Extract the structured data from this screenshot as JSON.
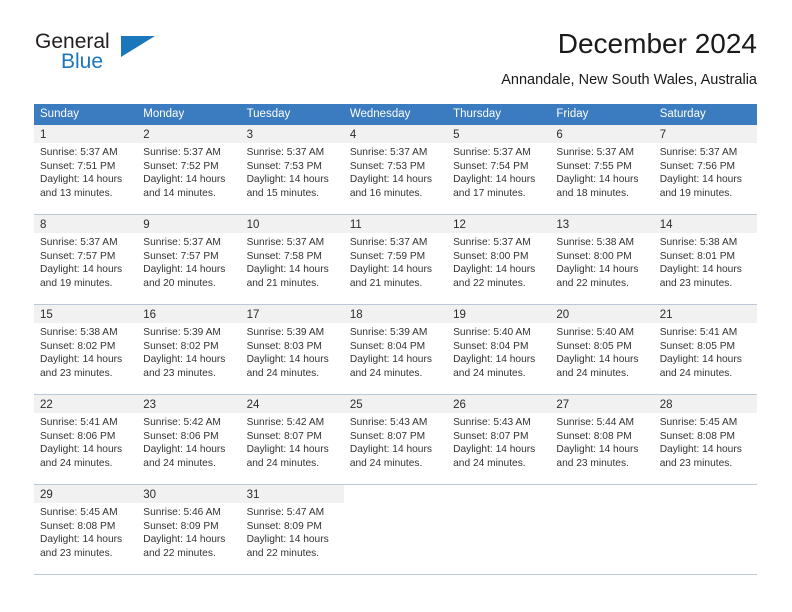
{
  "brand": {
    "name_part1": "General",
    "name_part2": "Blue",
    "triangle_color": "#1b76bc"
  },
  "header": {
    "title": "December 2024",
    "subtitle": "Annandale, New South Wales, Australia"
  },
  "theme": {
    "header_blue": "#3a7cbf",
    "daynum_band": "#f1f1f1",
    "row_divider": "#b9c9d8"
  },
  "calendar": {
    "weekdays": [
      "Sunday",
      "Monday",
      "Tuesday",
      "Wednesday",
      "Thursday",
      "Friday",
      "Saturday"
    ],
    "weeks": [
      [
        {
          "day": "1",
          "sunrise": "Sunrise: 5:37 AM",
          "sunset": "Sunset: 7:51 PM",
          "daylight1": "Daylight: 14 hours",
          "daylight2": "and 13 minutes."
        },
        {
          "day": "2",
          "sunrise": "Sunrise: 5:37 AM",
          "sunset": "Sunset: 7:52 PM",
          "daylight1": "Daylight: 14 hours",
          "daylight2": "and 14 minutes."
        },
        {
          "day": "3",
          "sunrise": "Sunrise: 5:37 AM",
          "sunset": "Sunset: 7:53 PM",
          "daylight1": "Daylight: 14 hours",
          "daylight2": "and 15 minutes."
        },
        {
          "day": "4",
          "sunrise": "Sunrise: 5:37 AM",
          "sunset": "Sunset: 7:53 PM",
          "daylight1": "Daylight: 14 hours",
          "daylight2": "and 16 minutes."
        },
        {
          "day": "5",
          "sunrise": "Sunrise: 5:37 AM",
          "sunset": "Sunset: 7:54 PM",
          "daylight1": "Daylight: 14 hours",
          "daylight2": "and 17 minutes."
        },
        {
          "day": "6",
          "sunrise": "Sunrise: 5:37 AM",
          "sunset": "Sunset: 7:55 PM",
          "daylight1": "Daylight: 14 hours",
          "daylight2": "and 18 minutes."
        },
        {
          "day": "7",
          "sunrise": "Sunrise: 5:37 AM",
          "sunset": "Sunset: 7:56 PM",
          "daylight1": "Daylight: 14 hours",
          "daylight2": "and 19 minutes."
        }
      ],
      [
        {
          "day": "8",
          "sunrise": "Sunrise: 5:37 AM",
          "sunset": "Sunset: 7:57 PM",
          "daylight1": "Daylight: 14 hours",
          "daylight2": "and 19 minutes."
        },
        {
          "day": "9",
          "sunrise": "Sunrise: 5:37 AM",
          "sunset": "Sunset: 7:57 PM",
          "daylight1": "Daylight: 14 hours",
          "daylight2": "and 20 minutes."
        },
        {
          "day": "10",
          "sunrise": "Sunrise: 5:37 AM",
          "sunset": "Sunset: 7:58 PM",
          "daylight1": "Daylight: 14 hours",
          "daylight2": "and 21 minutes."
        },
        {
          "day": "11",
          "sunrise": "Sunrise: 5:37 AM",
          "sunset": "Sunset: 7:59 PM",
          "daylight1": "Daylight: 14 hours",
          "daylight2": "and 21 minutes."
        },
        {
          "day": "12",
          "sunrise": "Sunrise: 5:37 AM",
          "sunset": "Sunset: 8:00 PM",
          "daylight1": "Daylight: 14 hours",
          "daylight2": "and 22 minutes."
        },
        {
          "day": "13",
          "sunrise": "Sunrise: 5:38 AM",
          "sunset": "Sunset: 8:00 PM",
          "daylight1": "Daylight: 14 hours",
          "daylight2": "and 22 minutes."
        },
        {
          "day": "14",
          "sunrise": "Sunrise: 5:38 AM",
          "sunset": "Sunset: 8:01 PM",
          "daylight1": "Daylight: 14 hours",
          "daylight2": "and 23 minutes."
        }
      ],
      [
        {
          "day": "15",
          "sunrise": "Sunrise: 5:38 AM",
          "sunset": "Sunset: 8:02 PM",
          "daylight1": "Daylight: 14 hours",
          "daylight2": "and 23 minutes."
        },
        {
          "day": "16",
          "sunrise": "Sunrise: 5:39 AM",
          "sunset": "Sunset: 8:02 PM",
          "daylight1": "Daylight: 14 hours",
          "daylight2": "and 23 minutes."
        },
        {
          "day": "17",
          "sunrise": "Sunrise: 5:39 AM",
          "sunset": "Sunset: 8:03 PM",
          "daylight1": "Daylight: 14 hours",
          "daylight2": "and 24 minutes."
        },
        {
          "day": "18",
          "sunrise": "Sunrise: 5:39 AM",
          "sunset": "Sunset: 8:04 PM",
          "daylight1": "Daylight: 14 hours",
          "daylight2": "and 24 minutes."
        },
        {
          "day": "19",
          "sunrise": "Sunrise: 5:40 AM",
          "sunset": "Sunset: 8:04 PM",
          "daylight1": "Daylight: 14 hours",
          "daylight2": "and 24 minutes."
        },
        {
          "day": "20",
          "sunrise": "Sunrise: 5:40 AM",
          "sunset": "Sunset: 8:05 PM",
          "daylight1": "Daylight: 14 hours",
          "daylight2": "and 24 minutes."
        },
        {
          "day": "21",
          "sunrise": "Sunrise: 5:41 AM",
          "sunset": "Sunset: 8:05 PM",
          "daylight1": "Daylight: 14 hours",
          "daylight2": "and 24 minutes."
        }
      ],
      [
        {
          "day": "22",
          "sunrise": "Sunrise: 5:41 AM",
          "sunset": "Sunset: 8:06 PM",
          "daylight1": "Daylight: 14 hours",
          "daylight2": "and 24 minutes."
        },
        {
          "day": "23",
          "sunrise": "Sunrise: 5:42 AM",
          "sunset": "Sunset: 8:06 PM",
          "daylight1": "Daylight: 14 hours",
          "daylight2": "and 24 minutes."
        },
        {
          "day": "24",
          "sunrise": "Sunrise: 5:42 AM",
          "sunset": "Sunset: 8:07 PM",
          "daylight1": "Daylight: 14 hours",
          "daylight2": "and 24 minutes."
        },
        {
          "day": "25",
          "sunrise": "Sunrise: 5:43 AM",
          "sunset": "Sunset: 8:07 PM",
          "daylight1": "Daylight: 14 hours",
          "daylight2": "and 24 minutes."
        },
        {
          "day": "26",
          "sunrise": "Sunrise: 5:43 AM",
          "sunset": "Sunset: 8:07 PM",
          "daylight1": "Daylight: 14 hours",
          "daylight2": "and 24 minutes."
        },
        {
          "day": "27",
          "sunrise": "Sunrise: 5:44 AM",
          "sunset": "Sunset: 8:08 PM",
          "daylight1": "Daylight: 14 hours",
          "daylight2": "and 23 minutes."
        },
        {
          "day": "28",
          "sunrise": "Sunrise: 5:45 AM",
          "sunset": "Sunset: 8:08 PM",
          "daylight1": "Daylight: 14 hours",
          "daylight2": "and 23 minutes."
        }
      ],
      [
        {
          "day": "29",
          "sunrise": "Sunrise: 5:45 AM",
          "sunset": "Sunset: 8:08 PM",
          "daylight1": "Daylight: 14 hours",
          "daylight2": "and 23 minutes."
        },
        {
          "day": "30",
          "sunrise": "Sunrise: 5:46 AM",
          "sunset": "Sunset: 8:09 PM",
          "daylight1": "Daylight: 14 hours",
          "daylight2": "and 22 minutes."
        },
        {
          "day": "31",
          "sunrise": "Sunrise: 5:47 AM",
          "sunset": "Sunset: 8:09 PM",
          "daylight1": "Daylight: 14 hours",
          "daylight2": "and 22 minutes."
        },
        {
          "day": "",
          "sunrise": "",
          "sunset": "",
          "daylight1": "",
          "daylight2": ""
        },
        {
          "day": "",
          "sunrise": "",
          "sunset": "",
          "daylight1": "",
          "daylight2": ""
        },
        {
          "day": "",
          "sunrise": "",
          "sunset": "",
          "daylight1": "",
          "daylight2": ""
        },
        {
          "day": "",
          "sunrise": "",
          "sunset": "",
          "daylight1": "",
          "daylight2": ""
        }
      ]
    ]
  }
}
